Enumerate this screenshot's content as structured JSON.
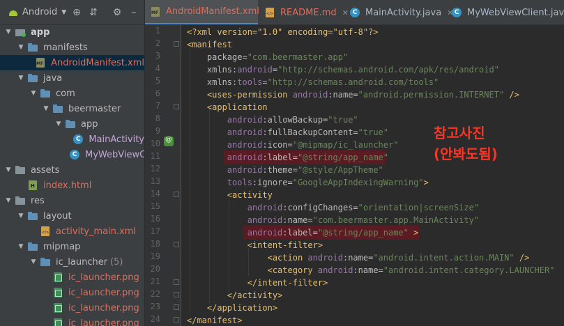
{
  "project_panel": {
    "view_selector": "Android",
    "tree": [
      {
        "label": "app",
        "indent": 0,
        "arrow": "▼",
        "icon": "module-icon",
        "style": "bold"
      },
      {
        "label": "manifests",
        "indent": 1,
        "arrow": "▼",
        "icon": "folder-icon",
        "style": ""
      },
      {
        "label": "AndroidManifest.xml",
        "indent": 2,
        "arrow": "",
        "icon": "manifest-icon",
        "style": "red",
        "selected": true
      },
      {
        "label": "java",
        "indent": 1,
        "arrow": "▼",
        "icon": "folder-icon",
        "style": ""
      },
      {
        "label": "com",
        "indent": 2,
        "arrow": "▼",
        "icon": "folder-icon",
        "style": ""
      },
      {
        "label": "beermaster",
        "indent": 3,
        "arrow": "▼",
        "icon": "folder-icon",
        "style": ""
      },
      {
        "label": "app",
        "indent": 4,
        "arrow": "▼",
        "icon": "folder-icon",
        "style": ""
      },
      {
        "label": "MainActivity",
        "indent": 5,
        "arrow": "",
        "icon": "class-icon",
        "style": "class"
      },
      {
        "label": "MyWebViewClient",
        "indent": 5,
        "arrow": "",
        "icon": "class-icon",
        "style": "class"
      },
      {
        "label": "assets",
        "indent": 0,
        "arrow": "▼",
        "icon": "folder-icon",
        "style": ""
      },
      {
        "label": "index.html",
        "indent": 1,
        "arrow": "",
        "icon": "html-icon",
        "style": "red"
      },
      {
        "label": "res",
        "indent": 0,
        "arrow": "▼",
        "icon": "folder-icon",
        "style": ""
      },
      {
        "label": "layout",
        "indent": 1,
        "arrow": "▼",
        "icon": "folder-icon",
        "style": ""
      },
      {
        "label": "activity_main.xml",
        "indent": 2,
        "arrow": "",
        "icon": "xml-icon",
        "style": "red"
      },
      {
        "label": "mipmap",
        "indent": 1,
        "arrow": "▼",
        "icon": "folder-icon",
        "style": ""
      },
      {
        "label": "ic_launcher",
        "indent": 2,
        "arrow": "▼",
        "icon": "folder-icon",
        "style": "",
        "count": "(5)"
      },
      {
        "label": "ic_launcher.png",
        "indent": 3,
        "arrow": "",
        "icon": "png-icon",
        "style": "red"
      },
      {
        "label": "ic_launcher.png",
        "indent": 3,
        "arrow": "",
        "icon": "png-icon",
        "style": "red"
      },
      {
        "label": "ic_launcher.png",
        "indent": 3,
        "arrow": "",
        "icon": "png-icon",
        "style": "red"
      },
      {
        "label": "ic_launcher.png",
        "indent": 3,
        "arrow": "",
        "icon": "png-icon",
        "style": "red"
      }
    ]
  },
  "tabs": [
    {
      "label": "AndroidManifest.xml",
      "icon": "manifest-icon",
      "active": true,
      "red": true
    },
    {
      "label": "README.md",
      "icon": "markdown-file-icon",
      "active": false,
      "red": true
    },
    {
      "label": "MainActivity.java",
      "icon": "class-icon",
      "active": false,
      "red": false
    },
    {
      "label": "MyWebViewClient.java",
      "icon": "class-icon",
      "active": false,
      "red": false
    }
  ],
  "editor": {
    "line_numbers": [
      "1",
      "2",
      "3",
      "4",
      "5",
      "6",
      "7",
      "8",
      "9",
      "10",
      "11",
      "12",
      "13",
      "14",
      "15",
      "16",
      "17",
      "18",
      "19",
      "20",
      "21",
      "22",
      "23",
      "24"
    ],
    "lines": [
      [
        [
          "proc",
          "<?xml version=\"1.0\" encoding=\"utf-8\"?>"
        ]
      ],
      [
        [
          "tag",
          "<manifest"
        ]
      ],
      [
        [
          "attr",
          "    package="
        ],
        [
          "val",
          "\"com.beermaster.app\""
        ]
      ],
      [
        [
          "attr",
          "    xmlns:"
        ],
        [
          "ns",
          "android"
        ],
        [
          "plain",
          "="
        ],
        [
          "val",
          "\"http://schemas.android.com/apk/res/android\""
        ]
      ],
      [
        [
          "attr",
          "    xmlns:"
        ],
        [
          "ns",
          "tools"
        ],
        [
          "plain",
          "="
        ],
        [
          "val",
          "\"http://schemas.android.com/tools\""
        ]
      ],
      [
        [
          "tag",
          "    <uses-permission "
        ],
        [
          "ns",
          "android"
        ],
        [
          "attr",
          ":name="
        ],
        [
          "val",
          "\"android.permission.INTERNET\""
        ],
        [
          "tag",
          " />"
        ]
      ],
      [
        [
          "tag",
          "    <application"
        ]
      ],
      [
        [
          "ns",
          "        android"
        ],
        [
          "attr",
          ":allowBackup="
        ],
        [
          "val",
          "\"true\""
        ]
      ],
      [
        [
          "ns",
          "        android"
        ],
        [
          "attr",
          ":fullBackupContent="
        ],
        [
          "val",
          "\"true\""
        ]
      ],
      [
        [
          "ns",
          "        android"
        ],
        [
          "attr",
          ":icon="
        ],
        [
          "val",
          "\"@mipmap/ic_launcher\""
        ]
      ],
      [
        [
          "ns",
          "        android"
        ],
        [
          "attr",
          ":label="
        ],
        [
          "val",
          "\"@string/app_name\""
        ]
      ],
      [
        [
          "ns",
          "        android"
        ],
        [
          "attr",
          ":theme="
        ],
        [
          "val",
          "\"@style/AppTheme\""
        ]
      ],
      [
        [
          "ns",
          "        tools"
        ],
        [
          "attr",
          ":ignore="
        ],
        [
          "val",
          "\"GoogleAppIndexingWarning\""
        ],
        [
          "tag",
          ">"
        ]
      ],
      [
        [
          "tag",
          "        <activity"
        ]
      ],
      [
        [
          "ns",
          "            android"
        ],
        [
          "attr",
          ":configChanges="
        ],
        [
          "val",
          "\"orientation|screenSize\""
        ]
      ],
      [
        [
          "ns",
          "            android"
        ],
        [
          "attr",
          ":name="
        ],
        [
          "val",
          "\"com.beermaster.app.MainActivity\""
        ]
      ],
      [
        [
          "ns",
          "            android"
        ],
        [
          "attr",
          ":label="
        ],
        [
          "val",
          "\"@string/app_name\""
        ],
        [
          "tag",
          " >"
        ]
      ],
      [
        [
          "tag",
          "            <intent-filter>"
        ]
      ],
      [
        [
          "tag",
          "                <action "
        ],
        [
          "ns",
          "android"
        ],
        [
          "attr",
          ":name="
        ],
        [
          "val",
          "\"android.intent.action.MAIN\""
        ],
        [
          "tag",
          " />"
        ]
      ],
      [
        [
          "tag",
          "                <category "
        ],
        [
          "ns",
          "android"
        ],
        [
          "attr",
          ":name="
        ],
        [
          "val",
          "\"android.intent.category.LAUNCHER\""
        ],
        [
          "tag",
          " />"
        ]
      ],
      [
        [
          "tag",
          "            </intent-filter>"
        ]
      ],
      [
        [
          "tag",
          "        </activity>"
        ]
      ],
      [
        [
          "tag",
          "    </application>"
        ]
      ],
      [
        [
          "tag",
          "</manifest>"
        ]
      ]
    ]
  },
  "annotation": {
    "line1": "참고사진",
    "line2": "(안봐도됨)"
  },
  "colors": {
    "highlight": "#5a1b22",
    "annotation": "#ff3322",
    "tab_underline": "#4a88c7"
  }
}
